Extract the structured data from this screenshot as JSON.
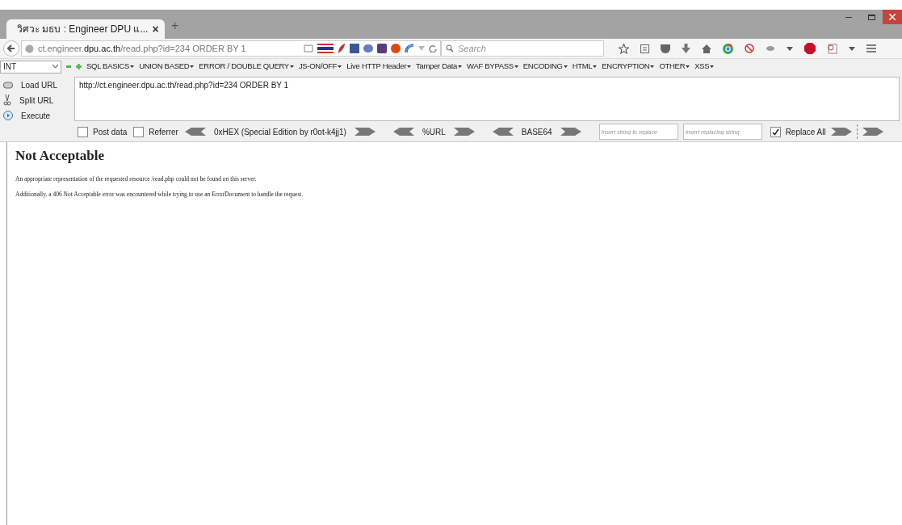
{
  "tab": {
    "title": "วิศวะ มธบ : Engineer DPU แ...",
    "close": "×"
  },
  "new_tab": "+",
  "address": {
    "url": "ct.engineer.**dpu.ac.th**/read.php?id=234 ORDER BY 1"
  },
  "search": {
    "placeholder": "Search"
  },
  "hackbar": {
    "select": "INT",
    "menus": [
      "SQL BASICS",
      "UNION BASED",
      "ERROR / DOUBLE QUERY",
      "JS-ON/OFF",
      "Live HTTP Header",
      "Tamper Data",
      "WAF BYPASS",
      "ENCODING",
      "HTML",
      "ENCRYPTION",
      "OTHER",
      "XSS"
    ],
    "actions": [
      {
        "kind": "load",
        "label": "Load URL"
      },
      {
        "kind": "split",
        "label": "Split URL"
      },
      {
        "kind": "execute",
        "label": "Execute"
      }
    ],
    "url_text": "http://ct.engineer.dpu.ac.th/read.php?id=234 ORDER BY 1",
    "options": [
      {
        "label": "Post data",
        "checked": false
      },
      {
        "label": "Referrer",
        "checked": false
      }
    ],
    "encoders": [
      "0xHEX (Special Edition by r0ot-k4jj1)",
      "%URL",
      "BASE64"
    ],
    "replace_fields": [
      {
        "placeholder": "Insert string to replace"
      },
      {
        "placeholder": "Insert replacing string"
      }
    ],
    "replace_all": {
      "label": "Replace All",
      "checked": true
    }
  },
  "page": {
    "heading": "Not Acceptable",
    "paragraphs": [
      "An appropriate representation of the requested resource /read.php could not be found on this server.",
      "Additionally, a 406 Not Acceptable error was encountered while trying to use an ErrorDocument to handle the request."
    ]
  }
}
